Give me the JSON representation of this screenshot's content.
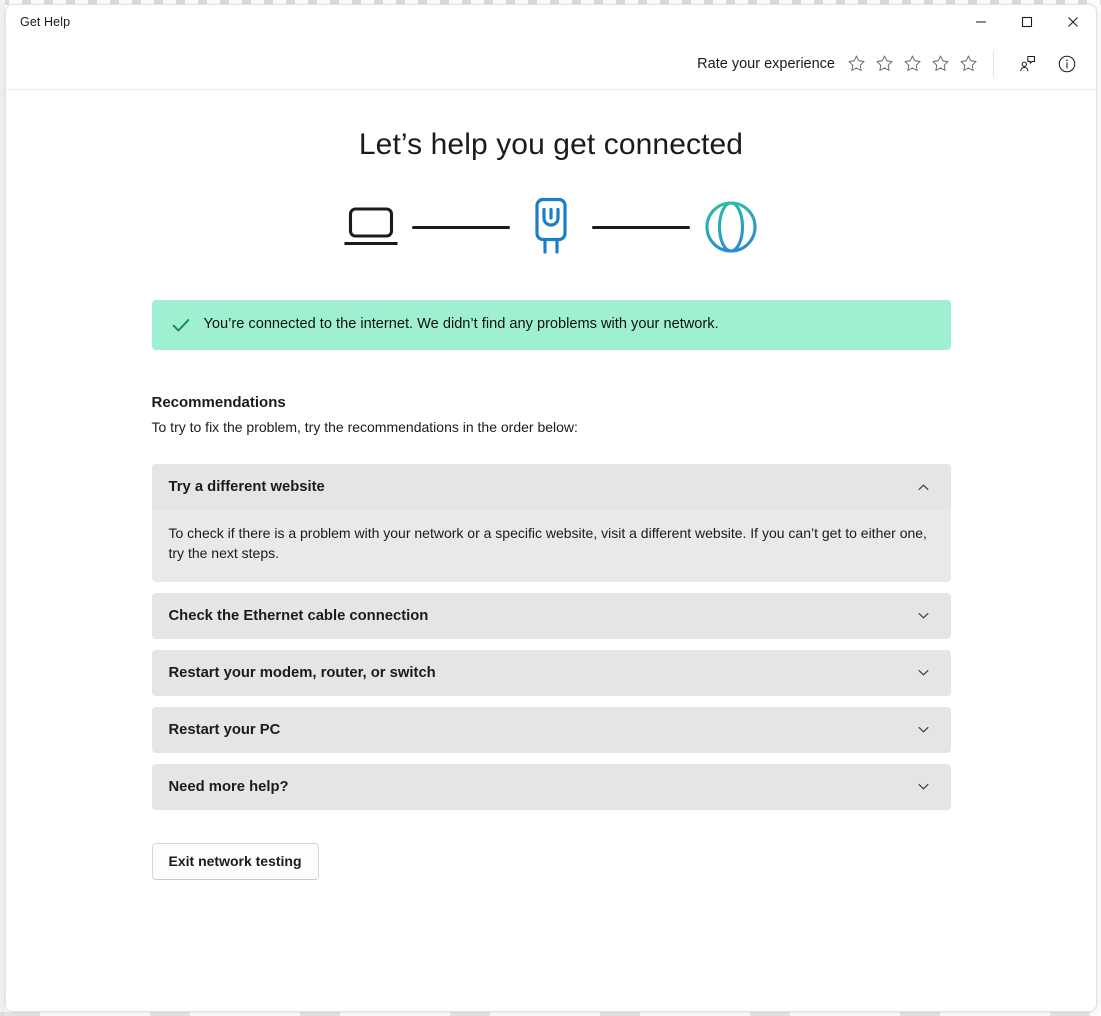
{
  "window": {
    "title": "Get Help",
    "controls": {
      "minimize": "minimize-icon",
      "maximize": "maximize-icon",
      "close": "close-icon"
    }
  },
  "commandbar": {
    "rate_label": "Rate your experience",
    "star_count": 5,
    "stars_filled": 0,
    "contact_icon": "contact-support-icon",
    "info_icon": "info-icon"
  },
  "main": {
    "heading": "Let’s help you get connected",
    "diagram": {
      "nodes": [
        {
          "name": "device-icon",
          "label": "PC",
          "color": "#1b1b1b"
        },
        {
          "name": "ethernet-connector-icon",
          "label": "Ethernet connector",
          "color": "#1a7fc4"
        },
        {
          "name": "globe-icon",
          "label": "Internet",
          "color": "#2bb4a4"
        }
      ],
      "connector_color": "#1b1b1b",
      "connector_count": 2
    },
    "banner": {
      "icon": "checkmark-icon",
      "icon_color": "#0e8a5f",
      "background": "#9ff0d0",
      "text": "You’re connected to the internet. We didn’t find any problems with your network."
    },
    "recommendations": {
      "title": "Recommendations",
      "subtitle": "To try to fix the problem, try the recommendations in the order below:",
      "items": [
        {
          "label": "Try a different website",
          "expanded": true,
          "chevron": "chevron-up-icon",
          "body": "To check if there is a problem with your network or a specific website, visit a different website. If you can’t get to either one, try the next steps."
        },
        {
          "label": "Check the Ethernet cable connection",
          "expanded": false,
          "chevron": "chevron-down-icon",
          "body": ""
        },
        {
          "label": "Restart your modem, router, or switch",
          "expanded": false,
          "chevron": "chevron-down-icon",
          "body": ""
        },
        {
          "label": "Restart your PC",
          "expanded": false,
          "chevron": "chevron-down-icon",
          "body": ""
        },
        {
          "label": "Need more help?",
          "expanded": false,
          "chevron": "chevron-down-icon",
          "body": ""
        }
      ]
    },
    "exit_button": "Exit network testing"
  },
  "colors": {
    "accent_blue": "#1a7fc4",
    "accent_teal": "#2bb4a4",
    "success_bg": "#9ff0d0",
    "success_fg": "#0e8a5f",
    "panel_header": "#e5e5e5",
    "panel_body": "#e9e9e9",
    "text": "#1b1b1b"
  }
}
